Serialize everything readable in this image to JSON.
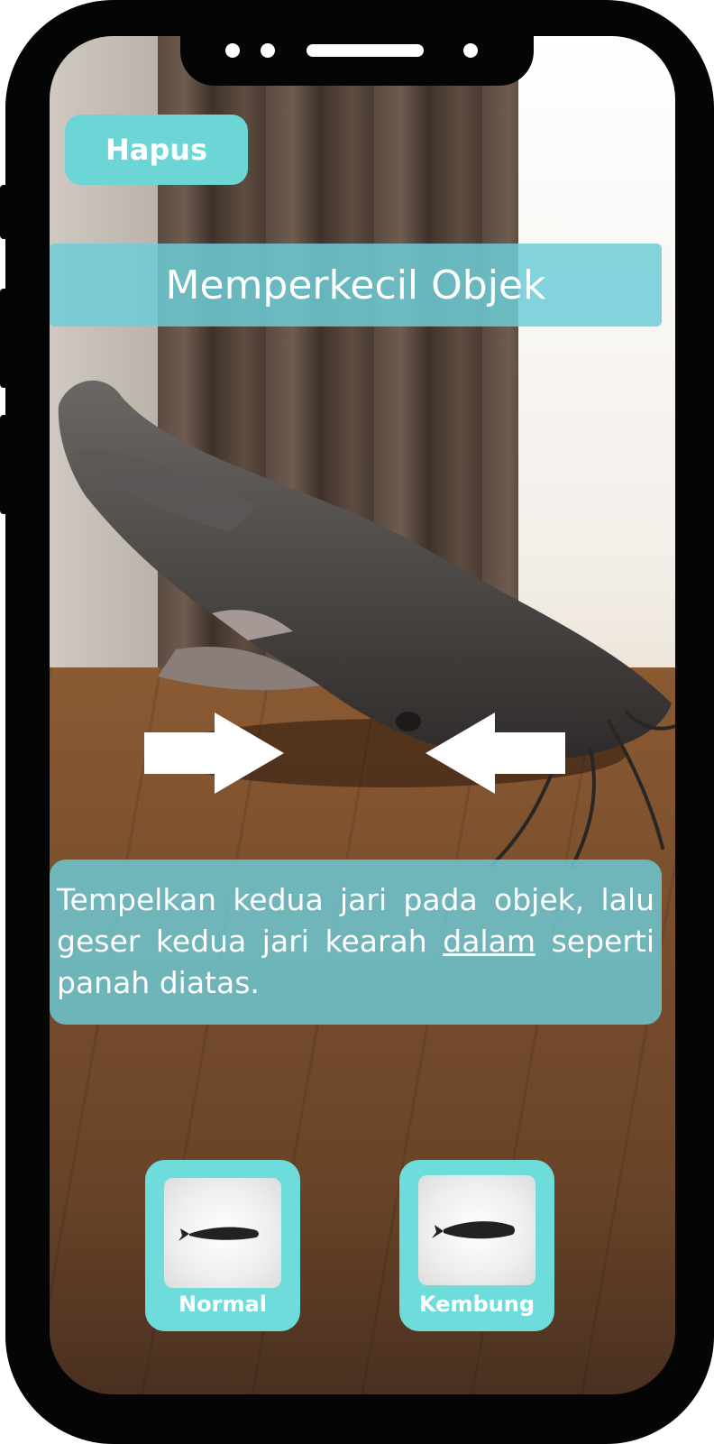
{
  "toolbar": {
    "hapus_label": "Hapus"
  },
  "title": "Memperkecil Objek",
  "instruction": {
    "before": "Tempelkan kedua jari pada objek, lalu geser kedua jari kearah ",
    "emphasis": "dalam",
    "after": " seperti panah diatas."
  },
  "choices": [
    {
      "label": "Normal",
      "icon": "fish-thumbnail"
    },
    {
      "label": "Kembung",
      "icon": "fish-thumbnail"
    }
  ],
  "colors": {
    "accent": "#6cd6d6",
    "banner": "#6dcdd6",
    "frame": "#050505"
  }
}
